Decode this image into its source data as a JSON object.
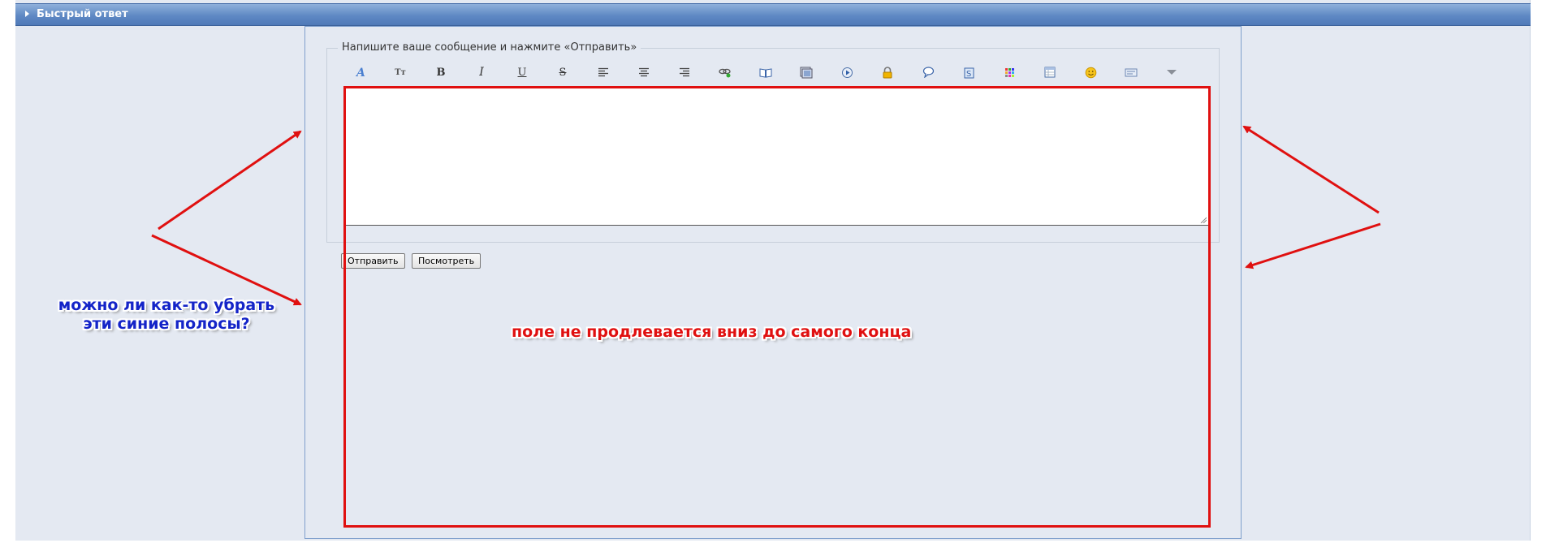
{
  "panel": {
    "title": "Быстрый ответ"
  },
  "form": {
    "legend": "Напишите ваше сообщение и нажмите «Отправить»",
    "textarea_value": "",
    "buttons": {
      "submit_label": "Отправить",
      "preview_label": "Посмотреть"
    }
  },
  "toolbar": {
    "items": [
      "font-icon",
      "font-size-icon",
      "bold-icon",
      "italic-icon",
      "underline-icon",
      "strikethrough-icon",
      "align-left-icon",
      "align-center-icon",
      "align-right-icon",
      "link-icon",
      "book-icon",
      "image-icon",
      "video-icon",
      "lock-icon",
      "quote-icon",
      "code-icon",
      "color-palette-icon",
      "table-icon",
      "smiley-icon",
      "spoiler-icon",
      "more-dropdown-icon"
    ],
    "labels": {
      "font_size": "Tт",
      "bold": "B",
      "italic": "I",
      "underline": "U",
      "strike": "S"
    }
  },
  "annotations": {
    "blue_question": "можно ли как-то убрать эти синие полосы?",
    "red_note": "поле не продлевается вниз до самого конца",
    "colors": {
      "red": "#e01010",
      "blue": "#1424c8"
    }
  }
}
